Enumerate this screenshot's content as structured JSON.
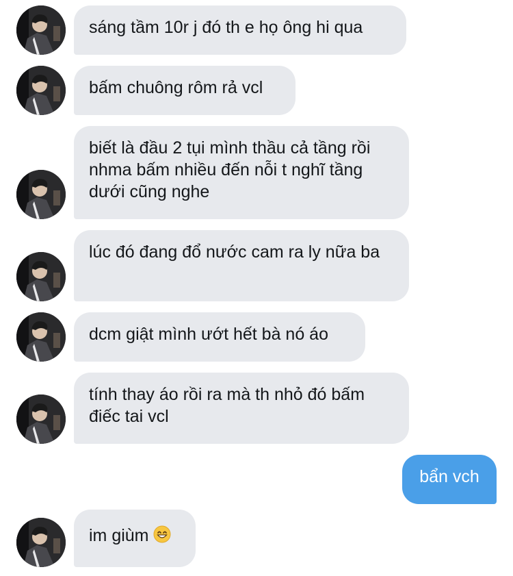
{
  "conversation": {
    "messages": [
      {
        "sender": "other",
        "text": "sáng tầm 10r j đó th e họ ông hi qua"
      },
      {
        "sender": "other",
        "text": "bấm chuông rôm rả vcl"
      },
      {
        "sender": "other",
        "text": "biết là đầu 2 tụi mình thầu cả tầng rồi nhma bấm nhiều đến nỗi t nghĩ tầng dưới cũng nghe"
      },
      {
        "sender": "other",
        "text": "lúc đó đang đổ nước cam ra ly nữa ba"
      },
      {
        "sender": "other",
        "text": "dcm giật mình ướt hết bà nó áo"
      },
      {
        "sender": "other",
        "text": "tính thay áo rồi ra mà th nhỏ đó bấm điếc tai vcl"
      },
      {
        "sender": "me",
        "text": "bẩn vch"
      },
      {
        "sender": "other",
        "text": "im giùm",
        "emoji": "grinning-face-icon"
      }
    ]
  },
  "colors": {
    "incoming_bubble": "#e7e9ed",
    "outgoing_bubble": "#4a9fe8",
    "incoming_text": "#14171a",
    "outgoing_text": "#ffffff"
  }
}
